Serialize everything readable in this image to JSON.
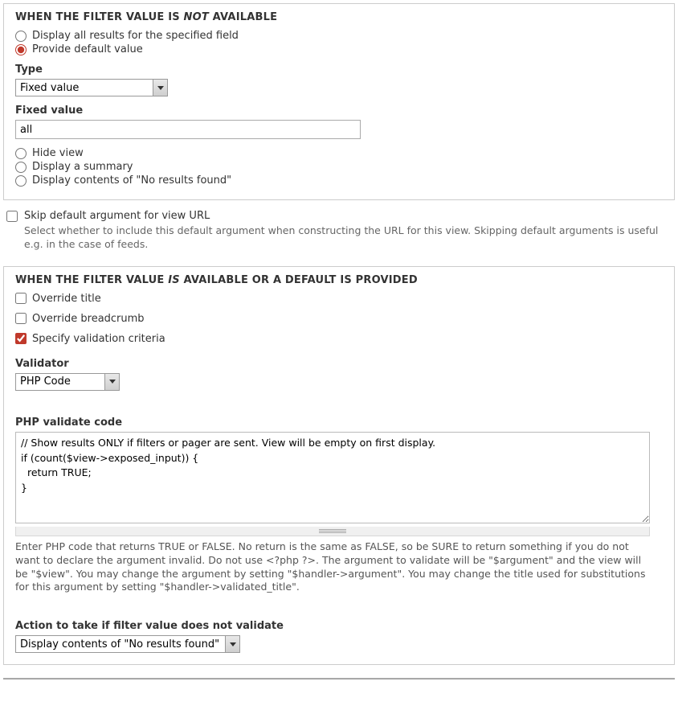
{
  "section_not": {
    "title_pre": "WHEN THE FILTER VALUE IS ",
    "title_em": "NOT",
    "title_post": " AVAILABLE",
    "radios": {
      "display_all": "Display all results for the specified field",
      "default_value": "Provide default value",
      "hide_view": "Hide view",
      "display_summary": "Display a summary",
      "display_no_results": "Display contents of \"No results found\""
    },
    "type_label": "Type",
    "type_value": "Fixed value",
    "fixed_label": "Fixed value",
    "fixed_value": "all"
  },
  "between": {
    "skip_label": "Skip default argument for view URL",
    "skip_desc": "Select whether to include this default argument when constructing the URL for this view. Skipping default arguments is useful e.g. in the case of feeds."
  },
  "section_is": {
    "title_pre": "WHEN THE FILTER VALUE ",
    "title_em": "IS",
    "title_post": " AVAILABLE OR A DEFAULT IS PROVIDED",
    "override_title": "Override title",
    "override_breadcrumb": "Override breadcrumb",
    "specify_validation": "Specify validation criteria",
    "validator_label": "Validator",
    "validator_value": "PHP Code",
    "php_code_label": "PHP validate code",
    "php_code_value": "// Show results ONLY if filters or pager are sent. View will be empty on first display.\nif (count($view->exposed_input)) {\n  return TRUE;\n}",
    "php_help": "Enter PHP code that returns TRUE or FALSE. No return is the same as FALSE, so be SURE to return something if you do not want to declare the argument invalid. Do not use <?php ?>. The argument to validate will be \"$argument\" and the view will be \"$view\". You may change the argument by setting \"$handler->argument\". You may change the title used for substitutions for this argument by setting \"$handler->validated_title\".",
    "action_label": "Action to take if filter value does not validate",
    "action_value": "Display contents of \"No results found\""
  }
}
